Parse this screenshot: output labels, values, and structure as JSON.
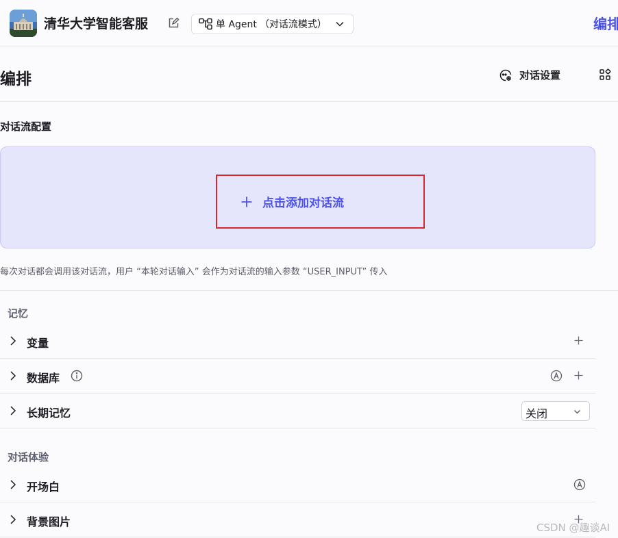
{
  "header": {
    "app_name": "清华大学智能客服",
    "mode_label": "单 Agent",
    "mode_sub": "（对话流模式）",
    "right_tab": "编排"
  },
  "page": {
    "title": "编排",
    "settings_label": "对话设置"
  },
  "flow": {
    "section_title": "对话流配置",
    "add_label": "点击添加对话流",
    "hint": "每次对话都会调用该对话流，用户 “本轮对话输入” 会作为对话流的输入参数 “USER_INPUT” 传入"
  },
  "memory": {
    "group_label": "记忆",
    "items": [
      {
        "label": "变量"
      },
      {
        "label": "数据库"
      },
      {
        "label": "长期记忆",
        "select_value": "关闭"
      }
    ]
  },
  "experience": {
    "group_label": "对话体验",
    "items": [
      {
        "label": "开场白"
      },
      {
        "label": "背景图片"
      }
    ]
  },
  "watermark": "CSDN @趣谈AI",
  "colors": {
    "accent": "#4d53e8",
    "flow_box_bg": "#e5e6fc",
    "highlight_border": "#d8252f"
  },
  "icons": [
    "edit-icon",
    "workflow-icon",
    "chevron-down-icon",
    "settings-icon",
    "grid-icon",
    "plus-icon",
    "chevron-right-icon",
    "info-icon",
    "auto-icon"
  ]
}
